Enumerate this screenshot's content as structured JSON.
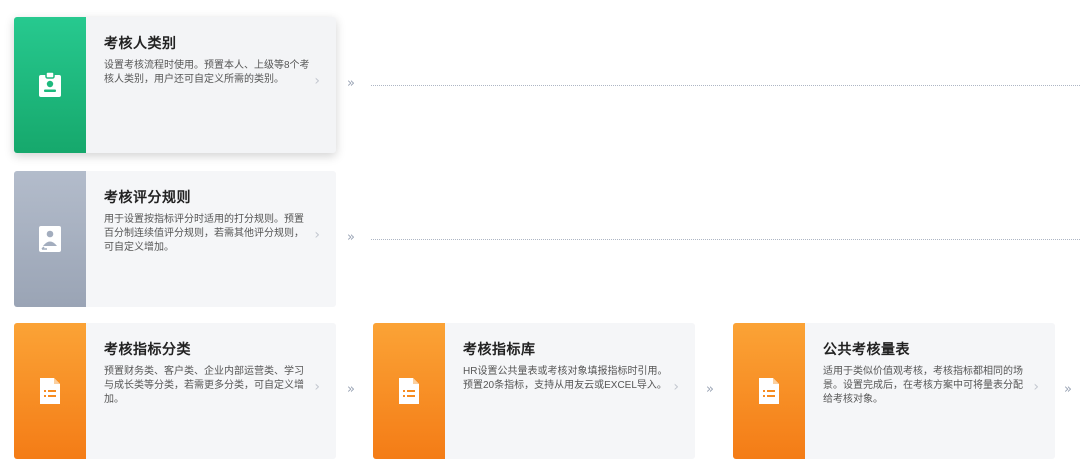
{
  "cards": [
    {
      "title": "考核人类别",
      "desc": "设置考核流程时使用。预置本人、上级等8个考核人类别，用户还可自定义所需的类别。",
      "icon": "badge-icon",
      "color": "#1db97d"
    },
    {
      "title": "考核评分规则",
      "desc": "用于设置按指标评分时适用的打分规则。预置百分制连续值评分规则，若需其他评分规则，可自定义增加。",
      "icon": "user-rule-icon",
      "color": "#a3adbe"
    },
    {
      "title": "考核指标分类",
      "desc": "预置财务类、客户类、企业内部运营类、学习与成长类等分类，若需更多分类，可自定义增加。",
      "icon": "document-list-icon",
      "color": "#f78c20"
    },
    {
      "title": "考核指标库",
      "desc": "HR设置公共量表或考核对象填报指标时引用。预置20条指标，支持从用友云或EXCEL导入。",
      "icon": "document-list-icon",
      "color": "#f78c20"
    },
    {
      "title": "公共考核量表",
      "desc": "适用于类似价值观考核，考核指标都相同的场景。设置完成后，在考核方案中可将量表分配给考核对象。",
      "icon": "document-list-icon",
      "color": "#f78c20"
    }
  ],
  "chevron": "›",
  "connector": "»"
}
